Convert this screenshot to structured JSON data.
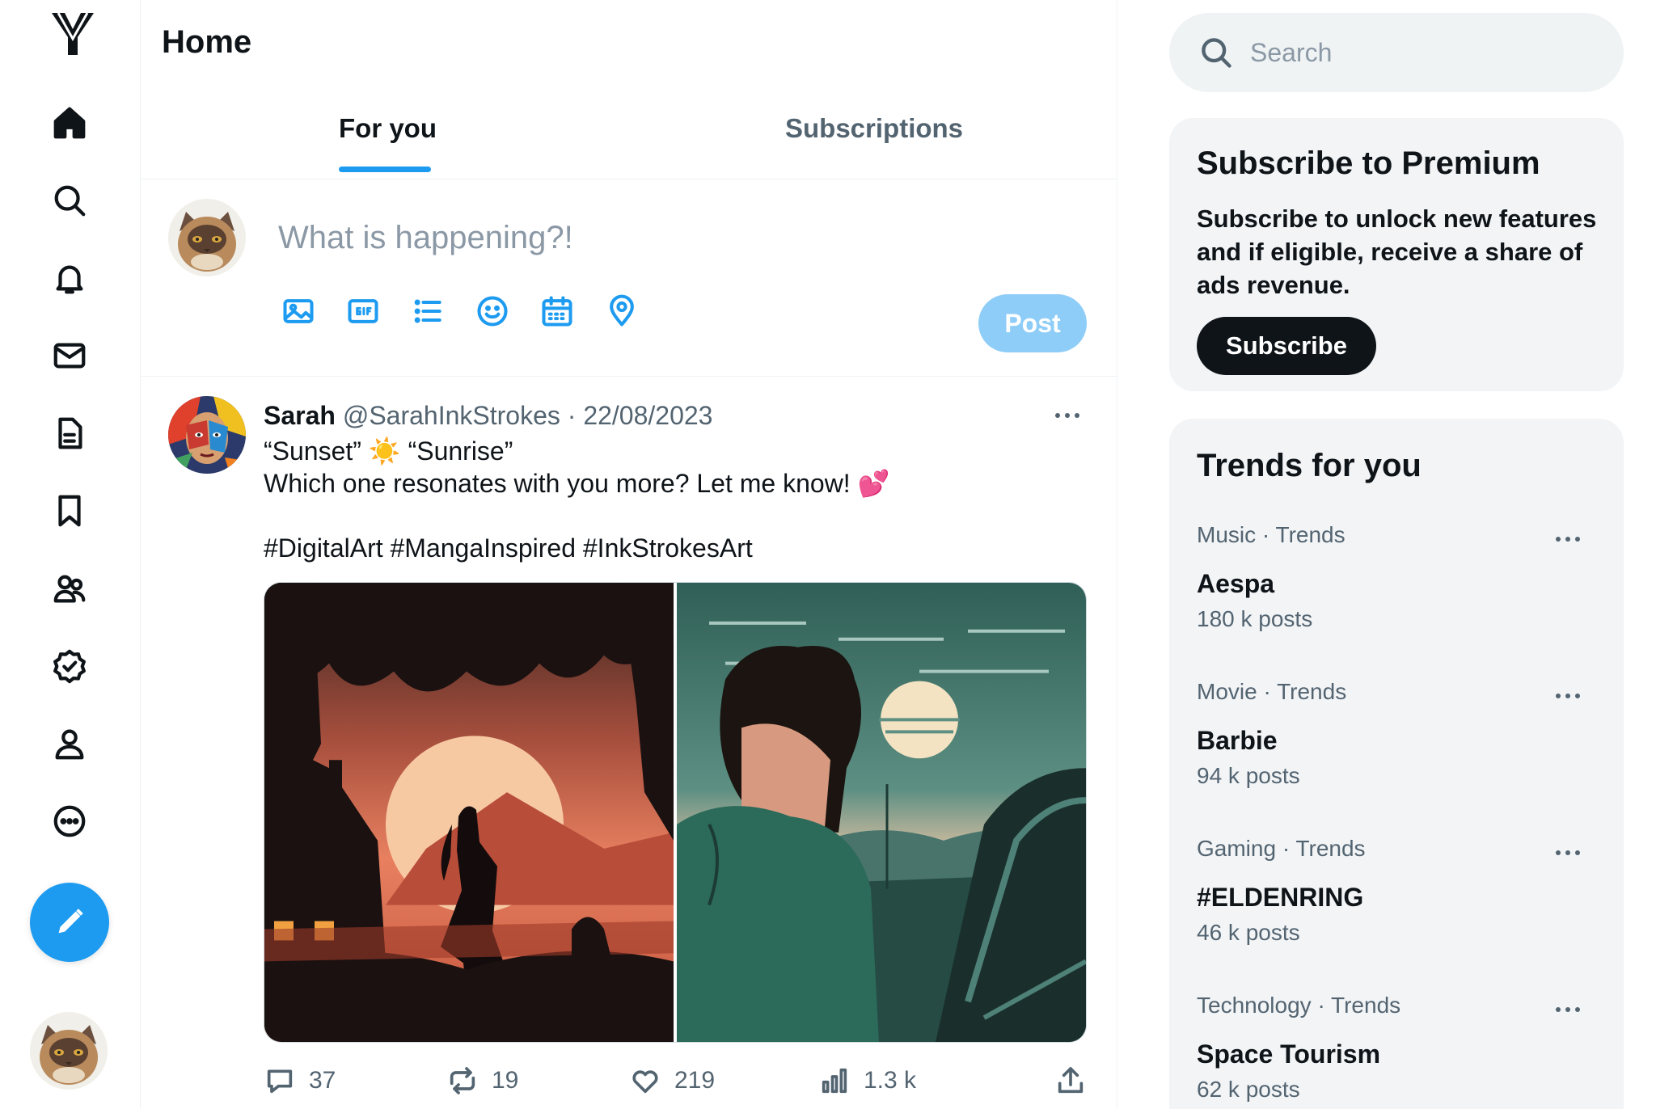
{
  "app": {
    "logo_icon": "y-logo-icon",
    "accent_color": "#1d9bf0"
  },
  "sidebar": {
    "items": [
      {
        "name": "home",
        "icon": "home-icon"
      },
      {
        "name": "explore",
        "icon": "search-icon"
      },
      {
        "name": "notifications",
        "icon": "bell-icon"
      },
      {
        "name": "messages",
        "icon": "mail-icon"
      },
      {
        "name": "lists",
        "icon": "document-icon"
      },
      {
        "name": "bookmarks",
        "icon": "bookmark-icon"
      },
      {
        "name": "communities",
        "icon": "people-icon"
      },
      {
        "name": "verified",
        "icon": "verified-check-icon"
      },
      {
        "name": "profile",
        "icon": "user-icon"
      },
      {
        "name": "more",
        "icon": "more-circle-icon"
      }
    ],
    "compose_icon": "pencil-icon"
  },
  "header": {
    "title": "Home"
  },
  "tabs": [
    {
      "label": "For you",
      "active": true
    },
    {
      "label": "Subscriptions",
      "active": false
    }
  ],
  "composer": {
    "placeholder": "What is happening?!",
    "tools": [
      "image-icon",
      "gif-icon",
      "list-icon",
      "emoji-icon",
      "schedule-icon",
      "location-icon"
    ],
    "post_label": "Post"
  },
  "tweet": {
    "name": "Sarah",
    "handle": "@SarahInkStrokes",
    "separator": "·",
    "date": "22/08/2023",
    "text": "“Sunset” ☀️ “Sunrise”\nWhich one resonates with you more? Let me know! 💕\n\n#DigitalArt #MangaInspired #InkStrokesArt",
    "actions": {
      "replies": "37",
      "reposts": "19",
      "likes": "219",
      "views": "1.3 k"
    }
  },
  "search": {
    "placeholder": "Search"
  },
  "premium": {
    "title": "Subscribe to Premium",
    "body": "Subscribe to unlock new features and if eligible, receive a share of ads revenue.",
    "button_label": "Subscribe"
  },
  "trends": {
    "title": "Trends for you",
    "items": [
      {
        "category": "Music",
        "sep": "·",
        "kind": "Trends",
        "name": "Aespa",
        "count": "180 k posts"
      },
      {
        "category": "Movie",
        "sep": "·",
        "kind": "Trends",
        "name": "Barbie",
        "count": "94 k posts"
      },
      {
        "category": "Gaming",
        "sep": "·",
        "kind": "Trends",
        "name": "#ELDENRING",
        "count": "46 k posts"
      },
      {
        "category": "Technology",
        "sep": "·",
        "kind": "Trends",
        "name": "Space Tourism",
        "count": "62 k posts"
      }
    ]
  }
}
